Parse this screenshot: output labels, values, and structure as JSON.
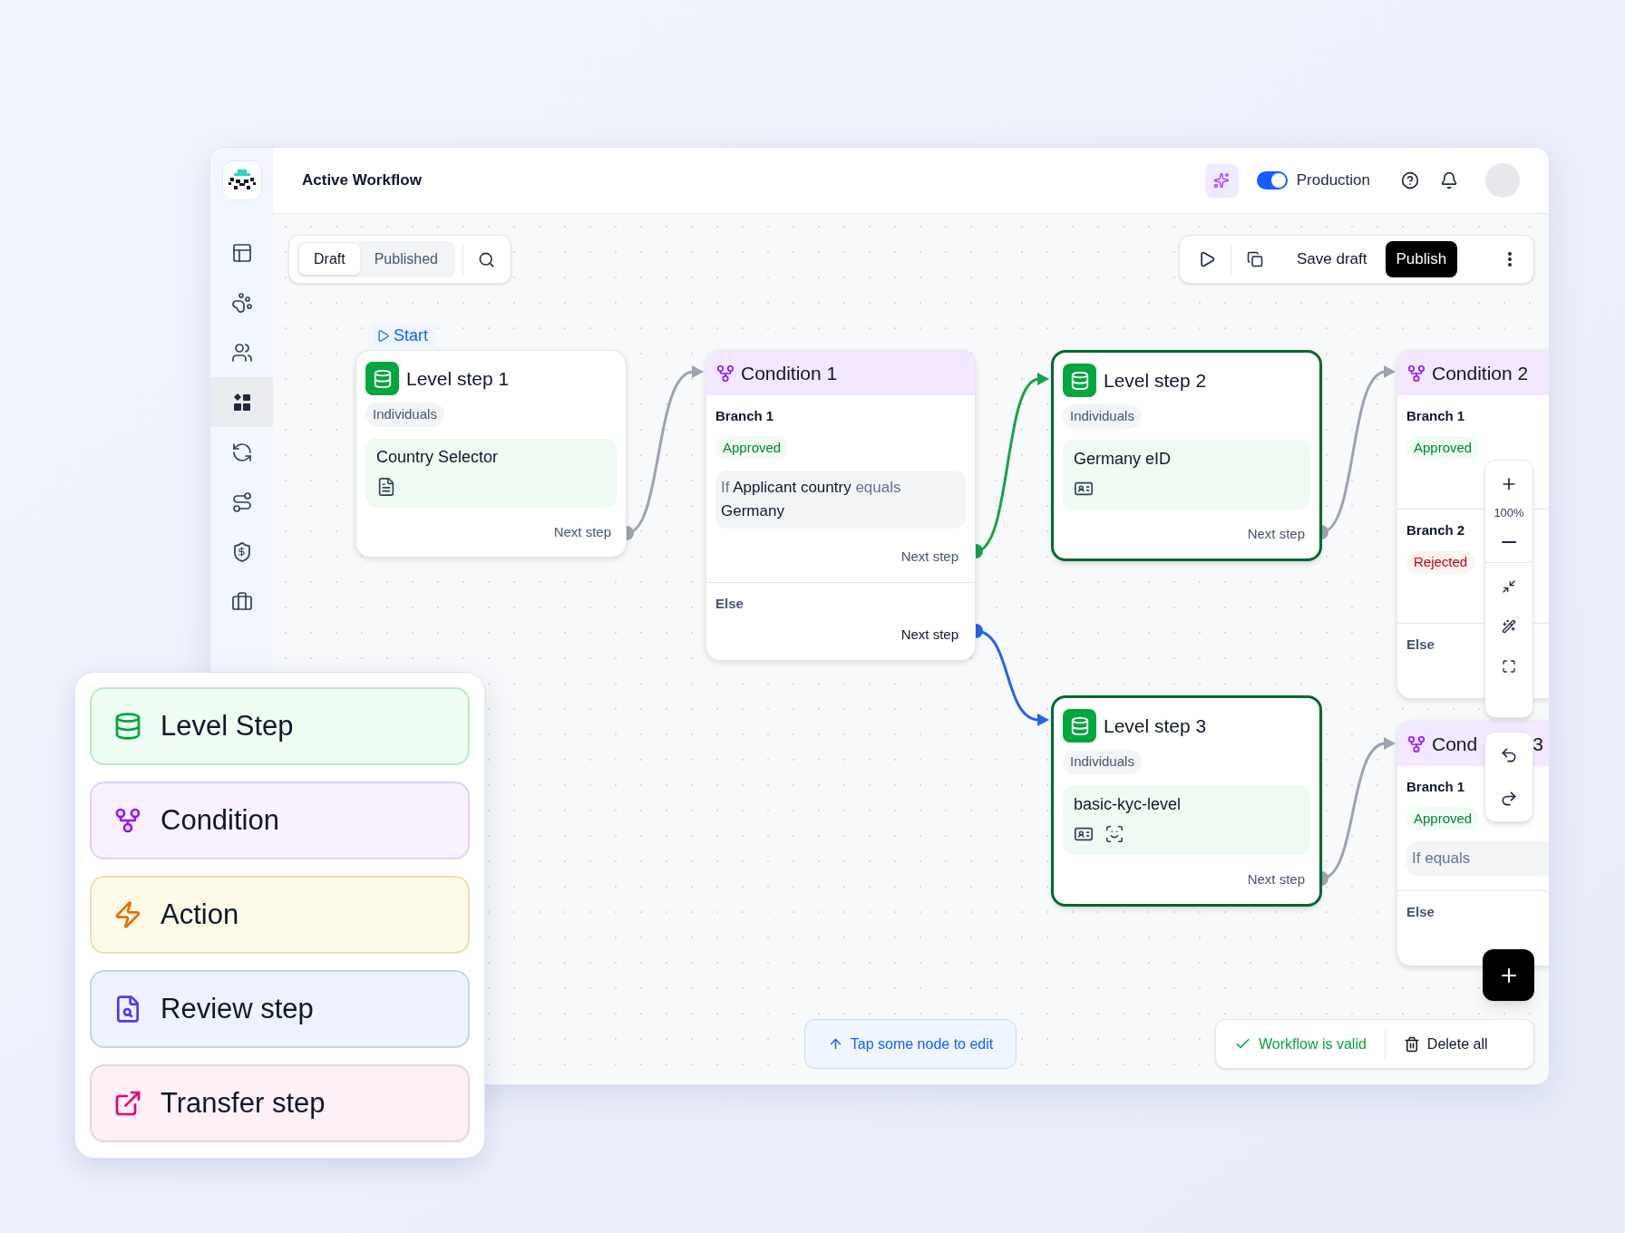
{
  "app": {
    "title": "Active Workflow"
  },
  "sidebar": {
    "items": [
      {
        "selected": false
      },
      {
        "selected": false
      },
      {
        "selected": false
      },
      {
        "selected": true
      },
      {
        "selected": false
      },
      {
        "selected": false
      },
      {
        "selected": false
      },
      {
        "selected": false
      }
    ]
  },
  "header": {
    "environment": {
      "label": "Production",
      "on": true
    }
  },
  "toolbar": {
    "tabs": [
      {
        "label": "Draft",
        "selected": true
      },
      {
        "label": "Published",
        "selected": false
      }
    ],
    "save": "Save draft",
    "publish": "Publish"
  },
  "nodes": [
    {
      "kind": "level",
      "start": "Start",
      "title": "Level step 1",
      "tag": "Individuals",
      "level_name": "Country Selector",
      "checks": [
        {
          "kind": "document"
        }
      ],
      "next": "Next step",
      "selected": false
    },
    {
      "kind": "condition",
      "title": "Condition 1",
      "branches": [
        {
          "label": "Branch 1",
          "status": {
            "label": "Approved",
            "kind": "approved"
          },
          "rule": [
            {
              "text": "If",
              "kind": "keyword"
            },
            {
              "text": "Applicant country",
              "kind": "value"
            },
            {
              "text": "equals",
              "kind": "keyword"
            },
            {
              "text": "Germany",
              "kind": "value"
            }
          ],
          "next": "Next step"
        }
      ],
      "else": {
        "label": "Else",
        "next": "Next step"
      }
    },
    {
      "kind": "level",
      "title": "Level step 2",
      "tag": "Individuals",
      "level_name": "Germany eID",
      "checks": [
        {
          "kind": "id-card"
        }
      ],
      "next": "Next step",
      "selected": true
    },
    {
      "kind": "condition",
      "title": "Condition 2",
      "branches": [
        {
          "label": "Branch 1",
          "status": {
            "label": "Approved",
            "kind": "approved"
          }
        },
        {
          "label": "Branch 2",
          "status": {
            "label": "Rejected",
            "kind": "rejected"
          }
        }
      ],
      "else": {
        "label": "Else"
      }
    },
    {
      "kind": "level",
      "title": "Level step 3",
      "tag": "Individuals",
      "level_name": "basic-kyc-level",
      "checks": [
        {
          "kind": "id-card"
        },
        {
          "kind": "face"
        }
      ],
      "next": "Next step",
      "selected": true
    },
    {
      "kind": "condition",
      "title": "Cond",
      "title_end": "3",
      "branches": [
        {
          "label": "Branch 1",
          "status": {
            "label": "Approved",
            "kind": "approved"
          },
          "rule": [
            {
              "text": "If",
              "kind": "keyword"
            },
            {
              "text": "equals",
              "kind": "keyword"
            }
          ]
        }
      ],
      "else": {
        "label": "Else"
      }
    }
  ],
  "edges": [
    {
      "color": "#9ca3af"
    },
    {
      "color": "#16a34a"
    },
    {
      "color": "#2563eb"
    },
    {
      "color": "#9ca3af"
    },
    {
      "color": "#9ca3af"
    }
  ],
  "zoom": {
    "reading": "100%"
  },
  "hint": "Tap some node to edit",
  "validation": {
    "label": "Workflow is valid",
    "delete": "Delete all"
  },
  "palette": [
    {
      "kind": "level",
      "label": "Level Step"
    },
    {
      "kind": "condition",
      "label": "Condition"
    },
    {
      "kind": "action",
      "label": "Action"
    },
    {
      "kind": "review",
      "label": "Review step"
    },
    {
      "kind": "transfer",
      "label": "Transfer step"
    }
  ]
}
